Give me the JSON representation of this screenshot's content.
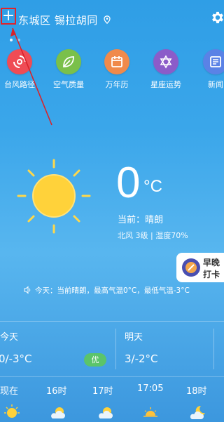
{
  "header": {
    "add_symbol": "+",
    "location": "东城区 锡拉胡同",
    "icons": [
      "plus-icon",
      "location-pin-icon",
      "gear-icon"
    ]
  },
  "shortcuts": [
    {
      "label": "台风路径",
      "icon": "typhoon-icon",
      "color": "#ef4c55"
    },
    {
      "label": "空气质量",
      "icon": "leaf-icon",
      "color": "#7ac04a"
    },
    {
      "label": "万年历",
      "icon": "calendar-icon",
      "color": "#f08a4b"
    },
    {
      "label": "星座运势",
      "icon": "star-of-david-icon",
      "color": "#8b5cc9"
    },
    {
      "label": "新闻",
      "icon": "news-icon",
      "color": "#5a82e6"
    }
  ],
  "current": {
    "temperature": "0",
    "unit": "°C",
    "condition": "当前：晴朗",
    "wind_humidity": "北风 3级 | 湿度70%"
  },
  "checkin": {
    "line1": "早晚",
    "line2": "打卡"
  },
  "today_message": "今天：当前晴朗，最高气温0°C，最低气温-3°C",
  "forecast": {
    "today": {
      "name": "今天",
      "range": "0/-3°C",
      "aqi": "优"
    },
    "tomorrow": {
      "name": "明天",
      "range": "3/-2°C"
    }
  },
  "hourly": [
    {
      "time": "现在",
      "icon": "sun-icon"
    },
    {
      "time": "16时",
      "icon": "partly-cloudy-icon"
    },
    {
      "time": "17时",
      "icon": "partly-cloudy-icon"
    },
    {
      "time": "17:05",
      "icon": "sunset-icon"
    },
    {
      "time": "18时",
      "icon": "cloudy-night-icon"
    }
  ],
  "colors": {
    "background_top": "#2f9ee6",
    "highlight_box": "#e0242a",
    "aqi_badge": "#5bc46a"
  }
}
